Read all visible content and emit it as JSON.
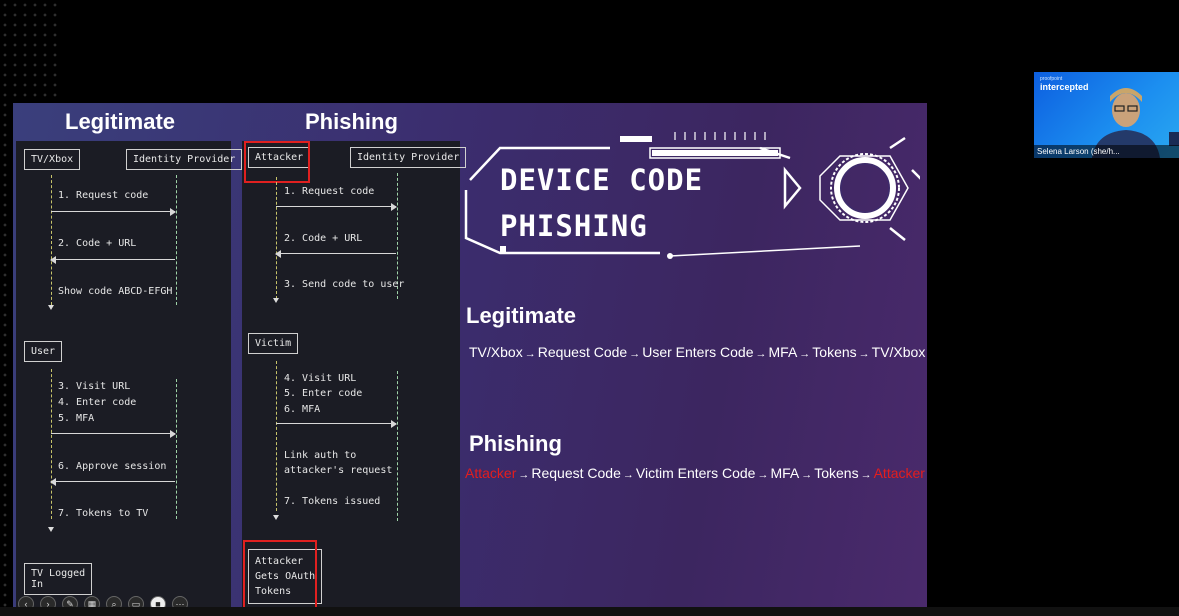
{
  "slide": {
    "header_legit": "Legitimate",
    "header_phish": "Phishing",
    "legit_panel": {
      "tv": "TV/Xbox",
      "idp": "Identity Provider",
      "s1": "1. Request code",
      "s2": "2. Code + URL",
      "show": "Show code ABCD-EFGH",
      "user": "User",
      "s3": "3. Visit URL",
      "s4": "4. Enter code",
      "s5": "5. MFA",
      "s6": "6. Approve session",
      "s7": "7. Tokens to TV",
      "logged1": "TV Logged",
      "logged2": "In"
    },
    "phish_panel": {
      "attacker": "Attacker",
      "idp": "Identity Provider",
      "s1": "1. Request code",
      "s2": "2. Code + URL",
      "s3": "3. Send code to user",
      "victim": "Victim",
      "s4": "4. Visit URL",
      "s5": "5. Enter code",
      "s6": "6. MFA",
      "link1": "Link auth to",
      "link2": "attacker's request",
      "s7": "7. Tokens issued",
      "gets1": "Attacker",
      "gets2": "Gets OAuth",
      "gets3": "Tokens"
    },
    "dc_title_1": "DEVICE CODE",
    "dc_title_2": "PHISHING",
    "legit_sub": "Legitimate",
    "legit_flow": [
      "TV/Xbox",
      "Request Code",
      "User Enters Code",
      "MFA",
      "Tokens",
      "TV/Xbox"
    ],
    "phish_sub": "Phishing",
    "phish_flow": [
      "Attacker",
      "Request Code",
      "Victim Enters Code",
      "MFA",
      "Tokens",
      "Attacker"
    ],
    "arrow": "→"
  },
  "camera": {
    "brand_small": "proofpoint",
    "brand": "intercepted",
    "name": "Selena Larson (she/h..."
  },
  "colors": {
    "accent_red": "#e41d1d",
    "panel_bg": "#1b1c24"
  }
}
